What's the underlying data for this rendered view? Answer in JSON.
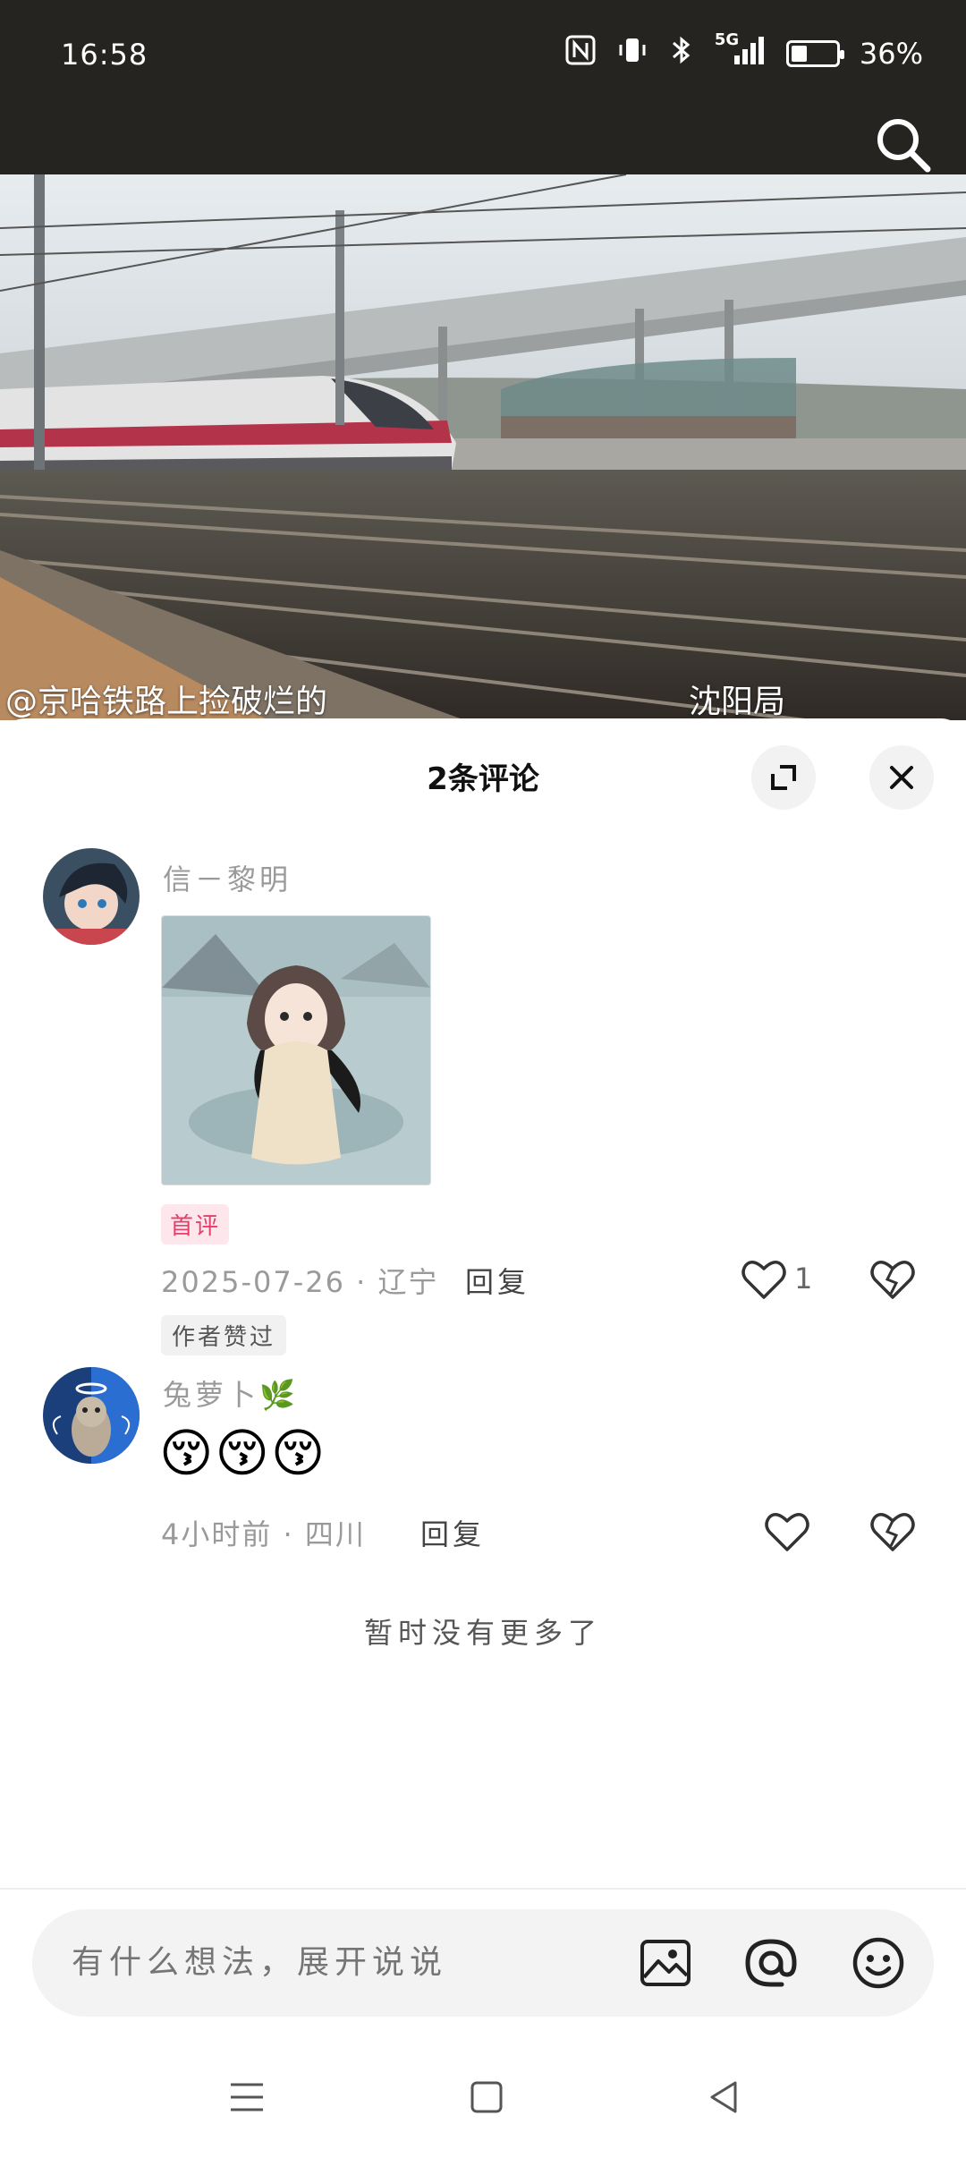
{
  "status_bar": {
    "time": "16:58",
    "network": "5G",
    "battery": "36%",
    "battery_fraction": 0.36
  },
  "video": {
    "overlay_left": "@京哈铁路上捡破烂的",
    "overlay_right": "沈阳局"
  },
  "sheet": {
    "title": "2条评论"
  },
  "comments": [
    {
      "username": "信－黎明",
      "tag_first": "首评",
      "meta": "2025-07-26 · 辽宁",
      "reply_label": "回复",
      "like_count": "1",
      "author_liked": "作者赞过"
    },
    {
      "username": "兔萝卜🌿",
      "emoji_text": "😚😚😚",
      "meta": "4小时前 · 四川",
      "reply_label": "回复"
    }
  ],
  "end_note": "暂时没有更多了",
  "input": {
    "placeholder": "有什么想法，展开说说"
  },
  "icons": {
    "search": "search-icon",
    "expand": "expand-icon",
    "close": "close-icon",
    "like": "heart-outline-icon",
    "dislike": "broken-heart-icon",
    "image": "image-icon",
    "at": "at-icon",
    "emoji": "emoji-icon"
  },
  "colors": {
    "status_bar_bg": "#262420",
    "tag_first": "#e5406a",
    "muted_text": "#9a9a9a"
  }
}
